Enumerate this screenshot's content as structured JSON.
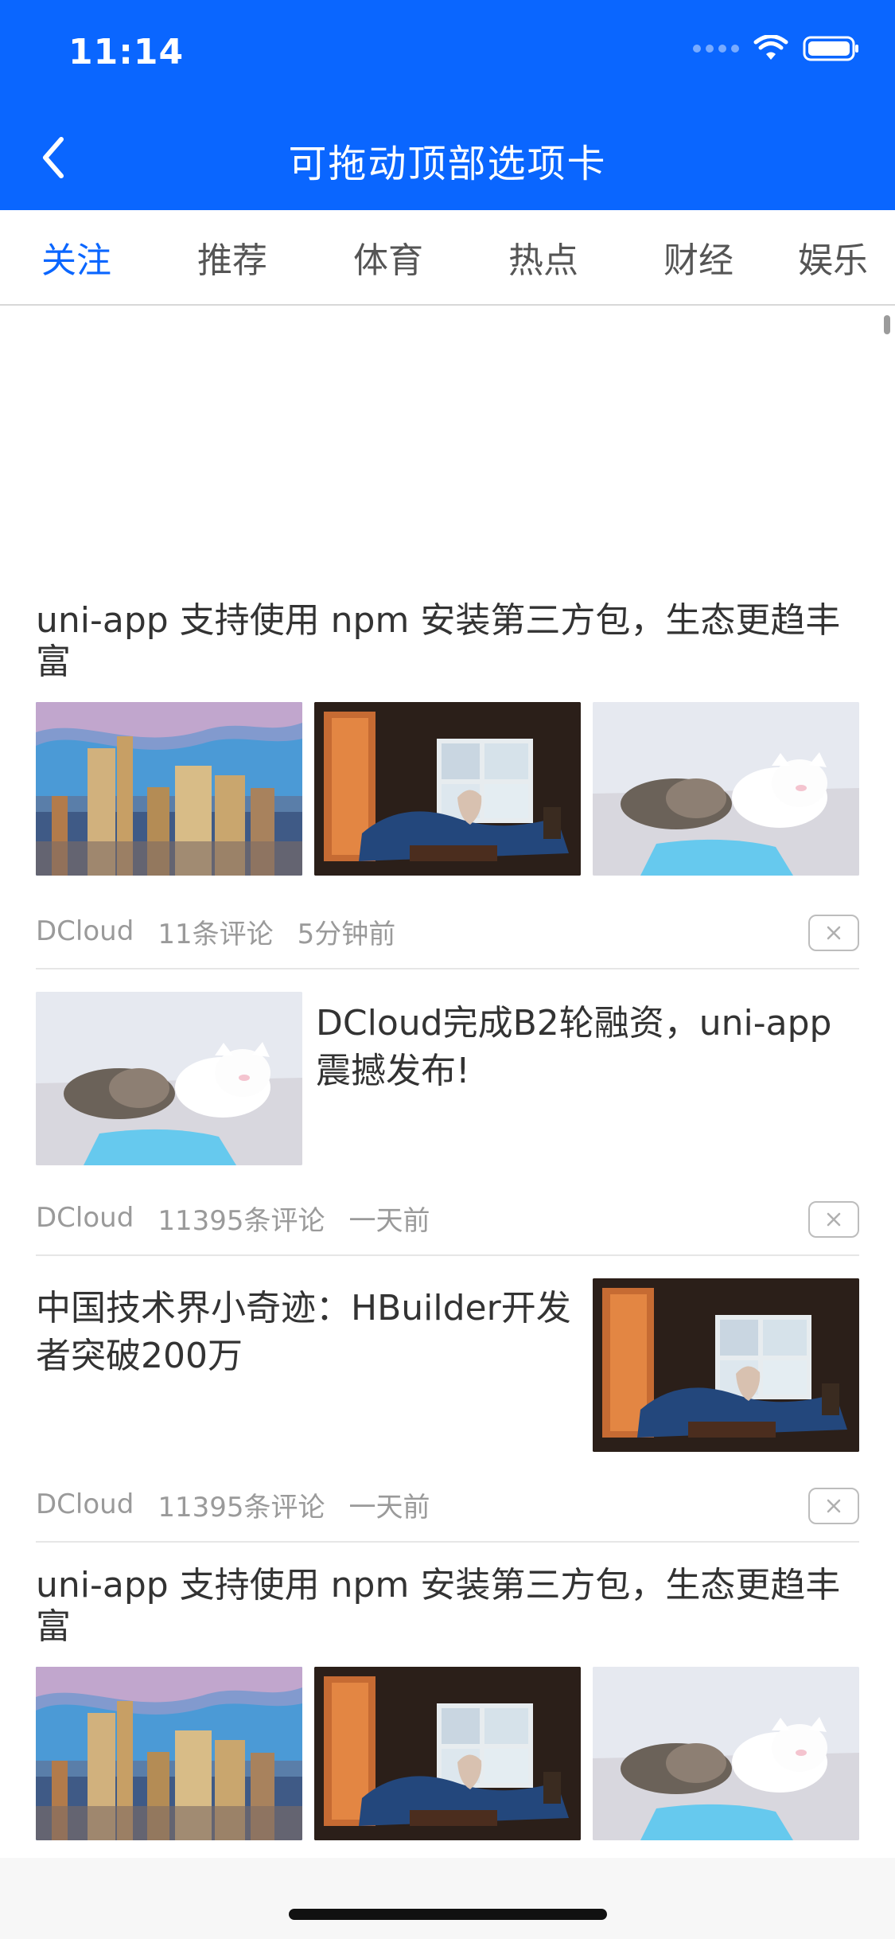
{
  "status": {
    "time": "11:14"
  },
  "nav": {
    "title": "可拖动顶部选项卡"
  },
  "tabs": [
    {
      "label": "关注",
      "active": true
    },
    {
      "label": "推荐",
      "active": false
    },
    {
      "label": "体育",
      "active": false
    },
    {
      "label": "热点",
      "active": false
    },
    {
      "label": "财经",
      "active": false
    },
    {
      "label": "娱乐",
      "active": false
    }
  ],
  "articles": [
    {
      "title": "uni-app 支持使用 npm 安装第三方包，生态更趋丰富",
      "source": "DCloud",
      "comments": "11条评论",
      "time": "5分钟前"
    },
    {
      "title": "DCloud完成B2轮融资，uni-app震撼发布!",
      "source": "DCloud",
      "comments": "11395条评论",
      "time": "一天前"
    },
    {
      "title": "中国技术界小奇迹：HBuilder开发者突破200万",
      "source": "DCloud",
      "comments": "11395条评论",
      "time": "一天前"
    },
    {
      "title": "uni-app 支持使用 npm 安装第三方包，生态更趋丰富"
    }
  ],
  "colors": {
    "accent": "#0a66ff",
    "tab_active": "#0a66ff",
    "meta_text": "#9a9a9a"
  },
  "icons": {
    "back": "chevron-left-icon",
    "wifi": "wifi-icon",
    "battery": "battery-icon",
    "close": "close-icon"
  }
}
